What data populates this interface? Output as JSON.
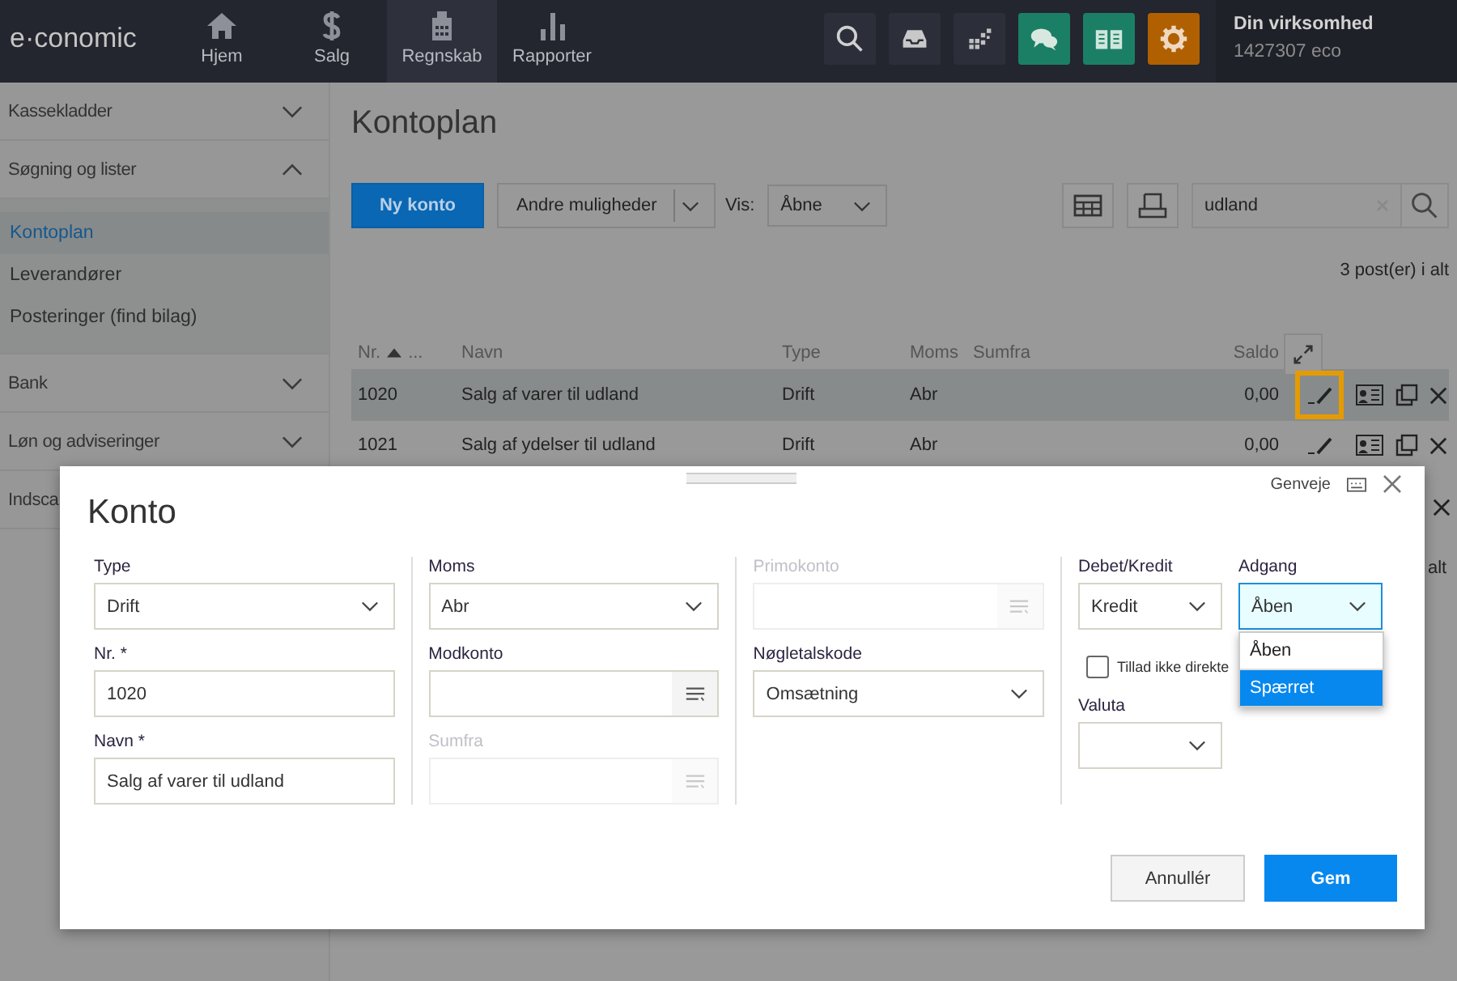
{
  "header": {
    "logo": "e·conomic",
    "nav": [
      {
        "label": "Hjem",
        "selected": false
      },
      {
        "label": "Salg",
        "selected": false
      },
      {
        "label": "Regnskab",
        "selected": true
      },
      {
        "label": "Rapporter",
        "selected": false
      }
    ],
    "tools": [
      {
        "color": "#2c2f3a"
      },
      {
        "color": "#2c2f3a"
      },
      {
        "color": "#2c2f3a"
      },
      {
        "color": "#1b7f66"
      },
      {
        "color": "#1b7f66"
      },
      {
        "color": "#b06000"
      }
    ],
    "account": {
      "name": "Din virksomhed",
      "number": "1427307 eco"
    }
  },
  "sidebar": [
    {
      "label": "Kassekladder",
      "expanded": false
    },
    {
      "label": "Søgning og lister",
      "expanded": true,
      "children": [
        {
          "label": "Kontoplan",
          "selected": true
        },
        {
          "label": "Leverandører",
          "selected": false
        },
        {
          "label": "Posteringer (find bilag)",
          "selected": false
        }
      ]
    },
    {
      "label": "Bank",
      "expanded": false
    },
    {
      "label": "Løn og adviseringer",
      "expanded": false
    },
    {
      "label": "Indsca"
    }
  ],
  "page": {
    "title": "Kontoplan",
    "new_button": "Ny konto",
    "more_button": "Andre muligheder",
    "view_label": "Vis:",
    "view_value": "Åbne",
    "search_value": "udland",
    "count": "3 post(er) i alt",
    "count_fragment": "alt"
  },
  "table": {
    "columns": [
      {
        "label": "Nr.",
        "sorted": true,
        "more": "..."
      },
      {
        "label": "Navn"
      },
      {
        "label": "Type"
      },
      {
        "label": "Moms"
      },
      {
        "label": "Sumfra"
      },
      {
        "label": "Saldo"
      }
    ],
    "rows": [
      {
        "nr": "1020",
        "name": "Salg af varer til udland",
        "type": "Drift",
        "moms": "Abr",
        "saldo": "0,00",
        "selected": true,
        "edit_focused": true
      },
      {
        "nr": "1021",
        "name": "Salg af ydelser til udland",
        "type": "Drift",
        "moms": "Abr",
        "saldo": "0,00",
        "selected": false,
        "edit_focused": false
      }
    ]
  },
  "dialog": {
    "title": "Konto",
    "shortcut_label": "Genveje",
    "columns": [
      [
        {
          "label": "Type",
          "kind": "select",
          "value": "Drift",
          "disabled": false
        },
        {
          "label": "Nr. *",
          "kind": "text",
          "value": "1020",
          "disabled": false
        },
        {
          "label": "Navn *",
          "kind": "text",
          "value": "Salg af varer til udland",
          "disabled": false
        }
      ],
      [
        {
          "label": "Moms",
          "kind": "select",
          "value": "Abr",
          "disabled": false
        },
        {
          "label": "Modkonto",
          "kind": "lookup",
          "disabled": false
        },
        {
          "label": "Sumfra",
          "kind": "lookup",
          "disabled": true
        }
      ],
      [
        {
          "label": "Primokonto",
          "kind": "lookup",
          "disabled": true
        },
        {
          "label": "Nøgletalskode",
          "kind": "select",
          "value": "Omsætning",
          "disabled": false
        }
      ]
    ],
    "debit_credit": {
      "label": "Debet/Kredit",
      "value": "Kredit"
    },
    "access": {
      "label": "Adgang",
      "value": "Åben",
      "expanded": true,
      "options": [
        {
          "label": "Åben",
          "highlighted": false
        },
        {
          "label": "Spærret",
          "highlighted": true
        }
      ]
    },
    "checkbox": {
      "label": "Tillad ikke direkte",
      "checked": false
    },
    "currency": {
      "label": "Valuta"
    },
    "cancel_button": "Annullér",
    "save_button": "Gem"
  }
}
